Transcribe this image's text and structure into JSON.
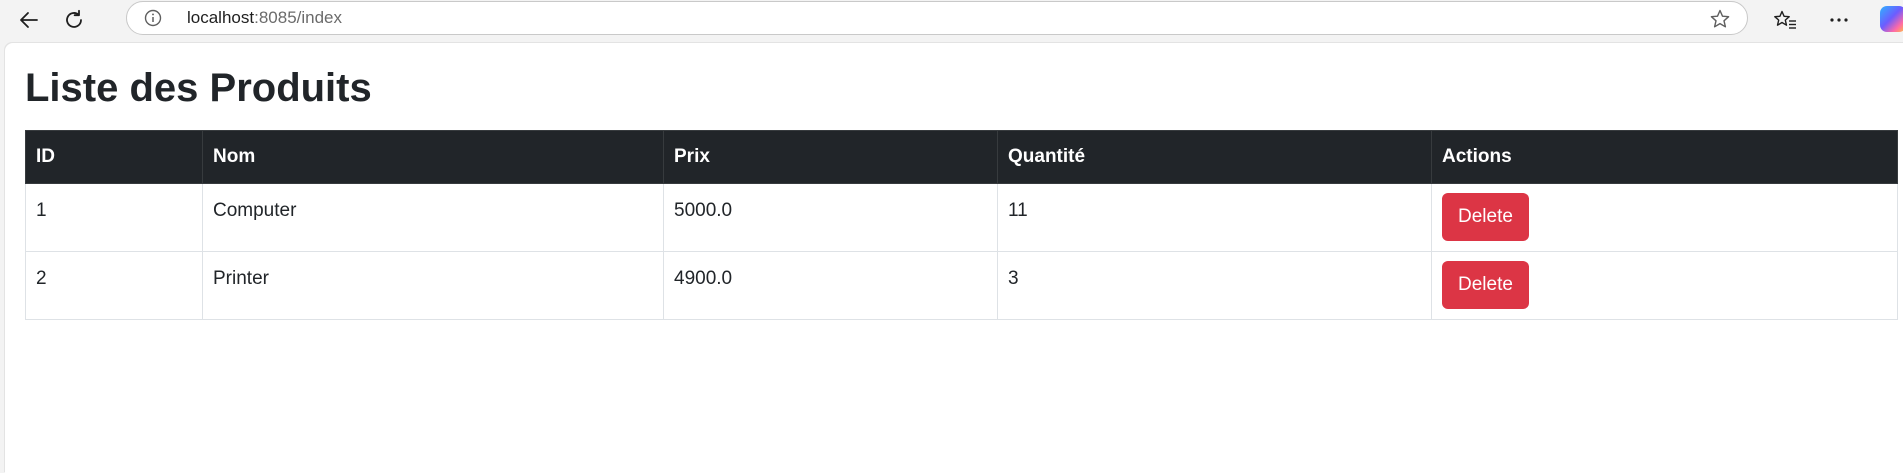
{
  "browser": {
    "url_host": "localhost",
    "url_path": ":8085/index"
  },
  "page": {
    "title": "Liste des Produits"
  },
  "table": {
    "headers": [
      "ID",
      "Nom",
      "Prix",
      "Quantité",
      "Actions"
    ],
    "rows": [
      {
        "id": "1",
        "nom": "Computer",
        "prix": "5000.0",
        "quantite": "11",
        "action_label": "Delete"
      },
      {
        "id": "2",
        "nom": "Printer",
        "prix": "4900.0",
        "quantite": "3",
        "action_label": "Delete"
      }
    ]
  },
  "colors": {
    "header_bg": "#212529",
    "delete_button": "#dc3545",
    "border": "#dee2e6"
  },
  "icons": {
    "back": "back-arrow-icon",
    "reload": "reload-icon",
    "site_info": "info-icon",
    "favorite": "star-icon",
    "favorites_list": "favorites-icon",
    "more": "more-icon",
    "copilot": "copilot-icon"
  }
}
